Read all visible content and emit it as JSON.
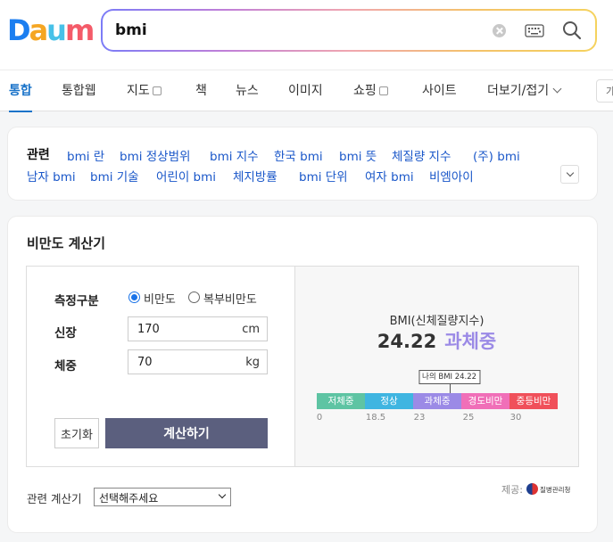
{
  "logo": {
    "letters": [
      "D",
      "a",
      "u",
      "m"
    ],
    "colors": [
      "#1b7ef0",
      "#f5a623",
      "#47c1e8",
      "#f45b69"
    ]
  },
  "search": {
    "query": "bmi"
  },
  "tabs": [
    {
      "label": "통합",
      "active": true
    },
    {
      "label": "통합웹"
    },
    {
      "label": "지도"
    },
    {
      "label": "책"
    },
    {
      "label": "뉴스"
    },
    {
      "label": "이미지"
    },
    {
      "label": "쇼핑"
    },
    {
      "label": "사이트"
    },
    {
      "label": "더보기/접기"
    }
  ],
  "tabs_cut_label": "가",
  "related": {
    "title": "관련",
    "links": [
      "bmi 란",
      "bmi 정상범위",
      "bmi 지수",
      "한국 bmi",
      "bmi 뜻",
      "체질량 지수",
      "(주) bmi",
      "남자 bmi",
      "bmi 기술",
      "어린이 bmi",
      "체지방률",
      "bmi 단위",
      "여자 bmi",
      "비엠아이"
    ]
  },
  "calculator": {
    "title": "비만도 계산기",
    "measure_label": "측정구분",
    "options": [
      "비만도",
      "복부비만도"
    ],
    "height_label": "신장",
    "height_value": "170",
    "height_unit": "cm",
    "weight_label": "체중",
    "weight_value": "70",
    "weight_unit": "kg",
    "reset_label": "초기화",
    "calc_label": "계산하기",
    "result_caption": "BMI(신체질량지수)",
    "bmi_value": "24.22",
    "bmi_status": "과체중",
    "marker_label": "나의 BMI 24.22",
    "marker_value": 24.22,
    "scale": [
      {
        "label": "저체중",
        "color": "#5ec4a3"
      },
      {
        "label": "정상",
        "color": "#3fb5e1"
      },
      {
        "label": "과체중",
        "color": "#9b8ae6"
      },
      {
        "label": "경도비만",
        "color": "#f06fb8"
      },
      {
        "label": "중등비만",
        "color": "#f0505a"
      }
    ],
    "ticks": [
      "0",
      "18.5",
      "23",
      "25",
      "30"
    ],
    "provider_label": "제공:",
    "provider_name": "질병관리청",
    "related_calc_label": "관련 계산기",
    "related_calc_select": "선택해주세요"
  }
}
